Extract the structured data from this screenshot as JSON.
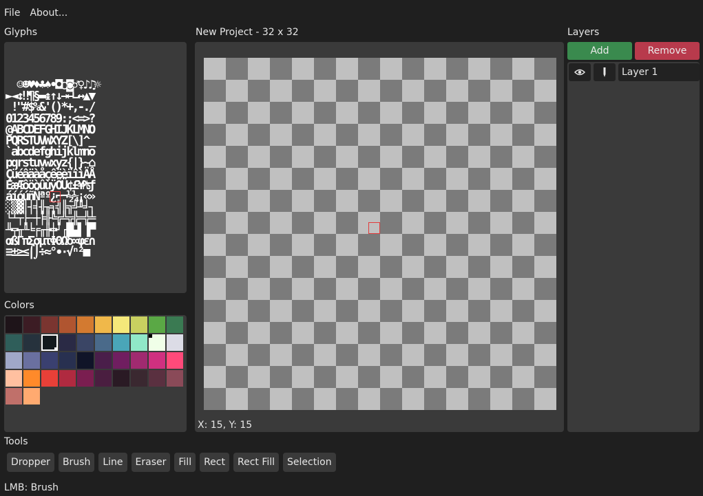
{
  "menu": {
    "items": [
      "File",
      "About..."
    ]
  },
  "glyphs": {
    "title": "Glyphs",
    "rows": [
      "  ☺☻♥♦♣♠•◘○◙♂♀♪♫☼",
      "►◄↕‼¶§▬↨↑↓→←∟↔▲▼",
      " !\"#$%&'()*+,-./",
      "0123456789:;<=>?",
      "@ABCDEFGHIJKLMNO",
      "PQRSTUVWXYZ[\\]^_",
      "`abcdefghijklmno",
      "pqrstuvwxyz{|}~⌂",
      "ÇüéâäàåçêëèïîìÄÅ",
      "ÉæÆôöòûùÿÖÜ¢£¥₧ƒ",
      "áíóúñÑªº¿⌐¬½¼¡«»",
      "░▒▓│┤╡╢╖╕╣║╗╝╜╛┐",
      "└┴┬├─┼╞╟╚╔╩╦╠═╬╧",
      "╨╤╥╙╘╒╓╫╪┘┌█▄▌▐▀",
      "αßΓπΣσµτΦΘΩδ∞φε∩",
      "≡±≥≤⌠⌡÷≈°∙·√ⁿ²■ "
    ]
  },
  "canvas": {
    "title": "New Project - 32 x 32",
    "coords": "X: 15, Y: 15"
  },
  "layers": {
    "title": "Layers",
    "add_label": "Add",
    "remove_label": "Remove",
    "items": [
      {
        "name": "Layer 1",
        "visible_icon": "eye-icon",
        "lock_icon": "pen-icon"
      }
    ]
  },
  "colors": {
    "title": "Colors",
    "selected_index": 12,
    "background_index": 18,
    "palette": [
      "#1e1419",
      "#3c1c24",
      "#7a3530",
      "#b05530",
      "#d37a30",
      "#f0b84a",
      "#f5e87a",
      "#c8d060",
      "#5aa845",
      "#3a7a52",
      "#2f5e5a",
      "#26323d",
      "#141a1e",
      "#2a2a45",
      "#3a4565",
      "#4a6a8a",
      "#4aa6b8",
      "#90e8c8",
      "#f0ffe8",
      "#dcdce6",
      "#a0a8c8",
      "#6a70a0",
      "#3a4070",
      "#283050",
      "#101428",
      "#4a1e4a",
      "#701e60",
      "#a02a70",
      "#d03080",
      "#ff4a7a",
      "#ffc0a0",
      "#ff8a2a",
      "#e84038",
      "#b02a40",
      "#7a1e50",
      "#4a1e40",
      "#2a1a24",
      "#3a2830",
      "#5a3040",
      "#8a4a58",
      "#c0706a",
      "#ffaa70"
    ]
  },
  "tools": {
    "title": "Tools",
    "items": [
      "Dropper",
      "Brush",
      "Line",
      "Eraser",
      "Fill",
      "Rect",
      "Rect Fill",
      "Selection"
    ]
  },
  "status": {
    "text": "LMB: Brush"
  }
}
